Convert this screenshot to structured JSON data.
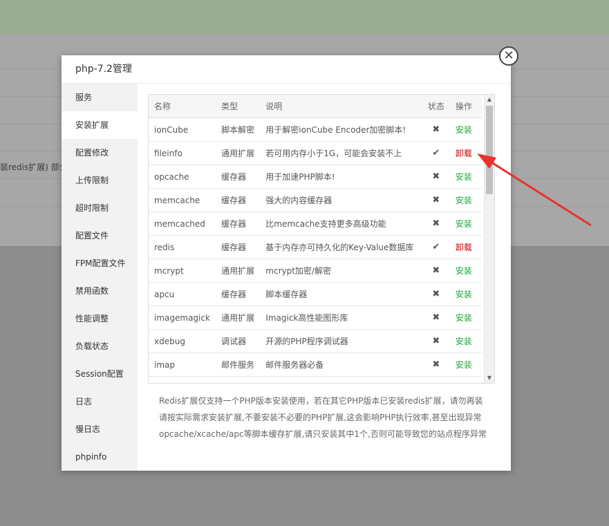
{
  "background": {
    "partial_text": "装redis扩展) 部分"
  },
  "dialog": {
    "title": "php-7.2管理",
    "close_icon": "close-icon"
  },
  "sidebar": {
    "items": [
      {
        "label": "服务",
        "active": false
      },
      {
        "label": "安装扩展",
        "active": true
      },
      {
        "label": "配置修改",
        "active": false
      },
      {
        "label": "上传限制",
        "active": false
      },
      {
        "label": "超时限制",
        "active": false
      },
      {
        "label": "配置文件",
        "active": false
      },
      {
        "label": "FPM配置文件",
        "active": false
      },
      {
        "label": "禁用函数",
        "active": false
      },
      {
        "label": "性能调整",
        "active": false
      },
      {
        "label": "负载状态",
        "active": false
      },
      {
        "label": "Session配置",
        "active": false
      },
      {
        "label": "日志",
        "active": false
      },
      {
        "label": "慢日志",
        "active": false
      },
      {
        "label": "phpinfo",
        "active": false
      }
    ]
  },
  "table": {
    "headers": {
      "name": "名称",
      "type": "类型",
      "desc": "说明",
      "status": "状态",
      "op": "操作"
    },
    "rows": [
      {
        "name": "ionCube",
        "type": "脚本解密",
        "desc": "用于解密ionCube Encoder加密脚本!",
        "status": "✖",
        "op": "安装",
        "installed": false
      },
      {
        "name": "fileinfo",
        "type": "通用扩展",
        "desc": "若可用内存小于1G，可能会安装不上",
        "status": "✔",
        "op": "卸载",
        "installed": true
      },
      {
        "name": "opcache",
        "type": "缓存器",
        "desc": "用于加速PHP脚本!",
        "status": "✖",
        "op": "安装",
        "installed": false
      },
      {
        "name": "memcache",
        "type": "缓存器",
        "desc": "强大的内容缓存器",
        "status": "✖",
        "op": "安装",
        "installed": false
      },
      {
        "name": "memcached",
        "type": "缓存器",
        "desc": "比memcache支持更多高级功能",
        "status": "✖",
        "op": "安装",
        "installed": false
      },
      {
        "name": "redis",
        "type": "缓存器",
        "desc": "基于内存亦可持久化的Key-Value数据库",
        "status": "✔",
        "op": "卸载",
        "installed": true
      },
      {
        "name": "mcrypt",
        "type": "通用扩展",
        "desc": "mcrypt加密/解密",
        "status": "✖",
        "op": "安装",
        "installed": false
      },
      {
        "name": "apcu",
        "type": "缓存器",
        "desc": "脚本缓存器",
        "status": "✖",
        "op": "安装",
        "installed": false
      },
      {
        "name": "imagemagick",
        "type": "通用扩展",
        "desc": "Imagick高性能图形库",
        "status": "✖",
        "op": "安装",
        "installed": false
      },
      {
        "name": "xdebug",
        "type": "调试器",
        "desc": "开源的PHP程序调试器",
        "status": "✖",
        "op": "安装",
        "installed": false
      },
      {
        "name": "imap",
        "type": "邮件服务",
        "desc": "邮件服务器必备",
        "status": "✖",
        "op": "安装",
        "installed": false
      }
    ]
  },
  "notes": [
    "Redis扩展仅支持一个PHP版本安装使用，若在其它PHP版本已安装redis扩展，请勿再装",
    "请按实际需求安装扩展,不要安装不必要的PHP扩展,这会影响PHP执行效率,甚至出现异常",
    "opcache/xcache/apc等脚本缓存扩展,请只安装其中1个,否则可能导致您的站点程序异常"
  ],
  "colors": {
    "install": "#20a53a",
    "uninstall": "#cc0000",
    "annotation_arrow": "#e8322f"
  }
}
